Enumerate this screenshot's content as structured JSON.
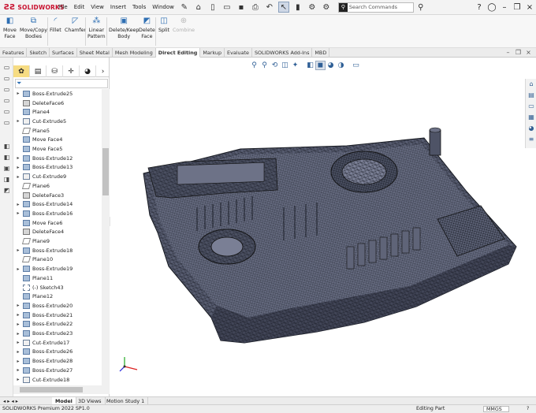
{
  "app": {
    "brand": "SOLIDWORKS",
    "menu": [
      "File",
      "Edit",
      "View",
      "Insert",
      "Tools",
      "Window"
    ],
    "search_placeholder": "Search Commands"
  },
  "ribbon": {
    "commands": [
      {
        "label": "Move\nFace",
        "enabled": true
      },
      {
        "label": "Move/Copy\nBodies",
        "enabled": true
      },
      {
        "label": "Fillet",
        "enabled": true
      },
      {
        "label": "Chamfer",
        "enabled": true
      },
      {
        "label": "Linear\nPattern",
        "enabled": true
      },
      {
        "label": "Delete/Keep\nBody",
        "enabled": true
      },
      {
        "label": "Delete\nFace",
        "enabled": true
      },
      {
        "label": "Split",
        "enabled": true
      },
      {
        "label": "Combine",
        "enabled": false
      }
    ]
  },
  "tabs": [
    "Features",
    "Sketch",
    "Surfaces",
    "Sheet Metal",
    "Mesh Modeling",
    "Direct Editing",
    "Markup",
    "Evaluate",
    "SOLIDWORKS Add-Ins",
    "MBD"
  ],
  "active_tab": "Direct Editing",
  "tree": [
    {
      "label": "Boss-Extrude25",
      "icon": "feat",
      "expand": true
    },
    {
      "label": "DeleteFace6",
      "icon": "face",
      "expand": false
    },
    {
      "label": "Plane4",
      "icon": "feat",
      "expand": false
    },
    {
      "label": "Cut-Extrude5",
      "icon": "cut",
      "expand": true
    },
    {
      "label": "Plane5",
      "icon": "plane",
      "expand": false
    },
    {
      "label": "Move Face4",
      "icon": "feat",
      "expand": false
    },
    {
      "label": "Move Face5",
      "icon": "feat",
      "expand": false
    },
    {
      "label": "Boss-Extrude12",
      "icon": "feat",
      "expand": true
    },
    {
      "label": "Boss-Extrude13",
      "icon": "feat",
      "expand": true
    },
    {
      "label": "Cut-Extrude9",
      "icon": "cut",
      "expand": true
    },
    {
      "label": "Plane6",
      "icon": "plane",
      "expand": false
    },
    {
      "label": "DeleteFace3",
      "icon": "face",
      "expand": false
    },
    {
      "label": "Boss-Extrude14",
      "icon": "feat",
      "expand": true
    },
    {
      "label": "Boss-Extrude16",
      "icon": "feat",
      "expand": true
    },
    {
      "label": "Move Face6",
      "icon": "feat",
      "expand": false
    },
    {
      "label": "DeleteFace4",
      "icon": "face",
      "expand": false
    },
    {
      "label": "Plane9",
      "icon": "plane",
      "expand": false
    },
    {
      "label": "Boss-Extrude18",
      "icon": "feat",
      "expand": true
    },
    {
      "label": "Plane10",
      "icon": "plane",
      "expand": false
    },
    {
      "label": "Boss-Extrude19",
      "icon": "feat",
      "expand": true
    },
    {
      "label": "Plane11",
      "icon": "feat",
      "expand": false
    },
    {
      "label": "(-) Sketch43",
      "icon": "sk",
      "expand": false
    },
    {
      "label": "Plane12",
      "icon": "feat",
      "expand": false
    },
    {
      "label": "Boss-Extrude20",
      "icon": "feat",
      "expand": true
    },
    {
      "label": "Boss-Extrude21",
      "icon": "feat",
      "expand": true
    },
    {
      "label": "Boss-Extrude22",
      "icon": "feat",
      "expand": true
    },
    {
      "label": "Boss-Extrude23",
      "icon": "feat",
      "expand": true
    },
    {
      "label": "Cut-Extrude17",
      "icon": "cut",
      "expand": true
    },
    {
      "label": "Boss-Extrude26",
      "icon": "feat",
      "expand": true
    },
    {
      "label": "Boss-Extrude28",
      "icon": "feat",
      "expand": true
    },
    {
      "label": "Boss-Extrude27",
      "icon": "feat",
      "expand": true
    },
    {
      "label": "Cut-Extrude18",
      "icon": "cut",
      "expand": true
    }
  ],
  "bottom_tabs": [
    "Model",
    "3D Views",
    "Motion Study 1"
  ],
  "active_bottom_tab": "Model",
  "status": {
    "version": "SOLIDWORKS Premium 2022 SP1.0",
    "mode": "Editing Part",
    "units": "MMGS"
  },
  "colors": {
    "brand": "#c8102e",
    "model": "#555a6e",
    "accent": "#2e6fb3"
  }
}
